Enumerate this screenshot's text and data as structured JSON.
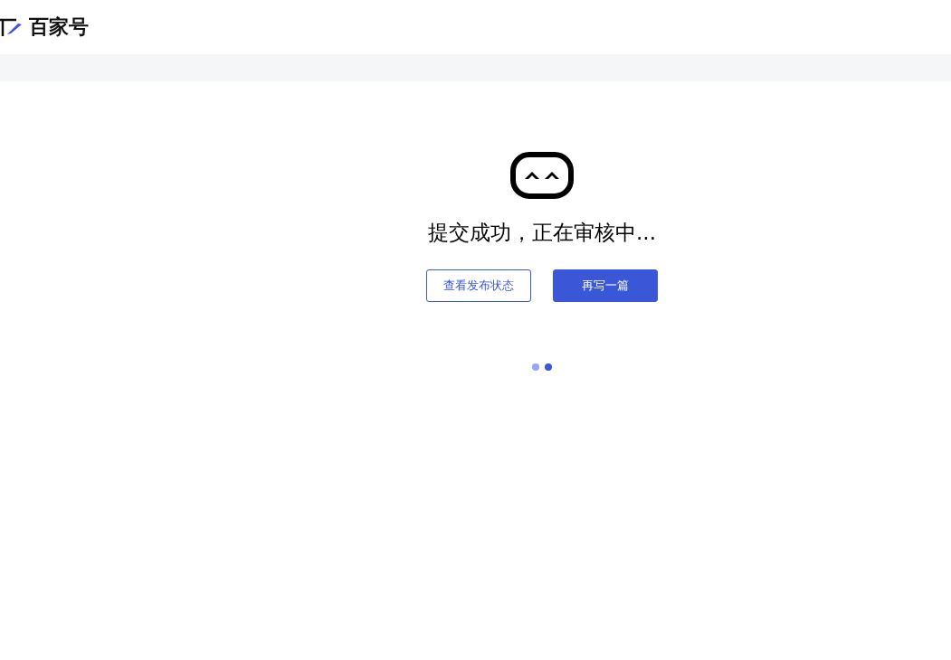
{
  "header": {
    "logo_text": "百家号"
  },
  "result": {
    "message": "提交成功，正在审核中...",
    "buttons": [
      {
        "label": "查看发布状态",
        "kind": "outline"
      },
      {
        "label": "再写一篇",
        "kind": "primary"
      }
    ]
  },
  "dots": [
    {
      "selected": false
    },
    {
      "selected": true
    }
  ]
}
